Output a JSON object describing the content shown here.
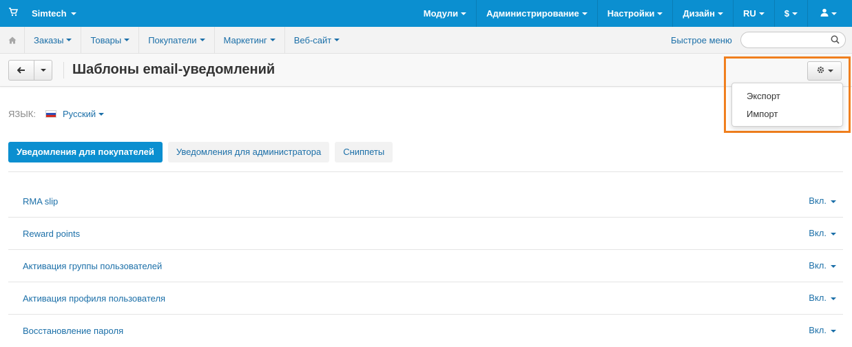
{
  "topbar": {
    "brand": "Simtech",
    "nav": [
      "Модули",
      "Администрирование",
      "Настройки",
      "Дизайн",
      "RU",
      "$"
    ],
    "icons": {
      "cart": "cart-icon",
      "user": "user-icon"
    }
  },
  "subbar": {
    "nav": [
      "Заказы",
      "Товары",
      "Покупатели",
      "Маркетинг",
      "Веб-сайт"
    ],
    "quick_menu": "Быстрое меню",
    "search_placeholder": ""
  },
  "page": {
    "title": "Шаблоны email-уведомлений"
  },
  "settings_menu": {
    "items": [
      "Экспорт",
      "Импорт"
    ]
  },
  "language": {
    "label": "ЯЗЫК:",
    "value": "Русский"
  },
  "tabs": [
    {
      "label": "Уведомления для покупателей",
      "active": true
    },
    {
      "label": "Уведомления для администратора",
      "active": false
    },
    {
      "label": "Сниппеты",
      "active": false
    }
  ],
  "templates": [
    {
      "name": "RMA slip",
      "status": "Вкл."
    },
    {
      "name": "Reward points",
      "status": "Вкл."
    },
    {
      "name": "Активация группы пользователей",
      "status": "Вкл."
    },
    {
      "name": "Активация профиля пользователя",
      "status": "Вкл."
    },
    {
      "name": "Восстановление пароля",
      "status": "Вкл."
    }
  ],
  "colors": {
    "topbar": "#0b8fd0",
    "link": "#1b6fa8",
    "highlight": "#f07f1e"
  }
}
